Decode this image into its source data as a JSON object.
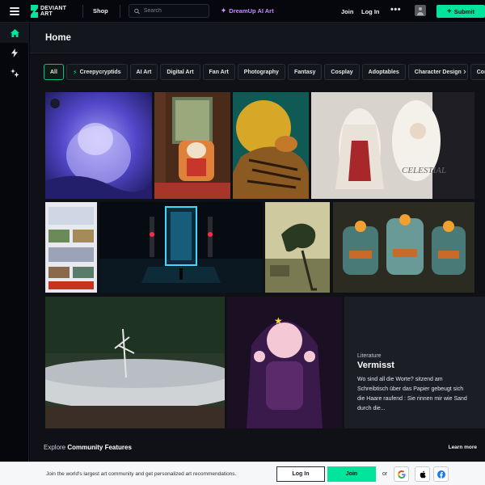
{
  "header": {
    "brand_line1": "DEVIANT",
    "brand_line2": "ART",
    "shop": "Shop",
    "search_placeholder": "Search",
    "dreamup": "DreamUp AI Art",
    "join": "Join",
    "login": "Log In",
    "more": "•••",
    "submit": "Submit"
  },
  "page": {
    "title": "Home"
  },
  "chips": [
    "All",
    "Creepycryptids",
    "AI Art",
    "Digital Art",
    "Fan Art",
    "Photography",
    "Fantasy",
    "Cosplay",
    "Adoptables",
    "Character Design",
    "Comic"
  ],
  "literature": {
    "category": "Literature",
    "title": "Vermisst",
    "excerpt": "Wo sind all die Worte? sitzend am Schreibtisch über das Papier gebeugt sich die Haare raufend : Sie rinnen mir wie Sand durch die..."
  },
  "explore": {
    "prefix": "Explore",
    "title": "Community Features",
    "learn_more": "Learn more"
  },
  "banner": {
    "text": "Join the world's largest art community and get personalized art recommendations.",
    "login": "Log In",
    "join": "Join",
    "or": "or"
  },
  "colors": {
    "accent": "#00e59b",
    "background": "#0f1117",
    "dreamup": "#c78bff"
  },
  "icons": [
    "menu-icon",
    "home-icon",
    "bolt-icon",
    "spark-icon",
    "search-icon",
    "dreamup-icon",
    "plus-icon",
    "google-icon",
    "apple-icon",
    "facebook-icon"
  ]
}
